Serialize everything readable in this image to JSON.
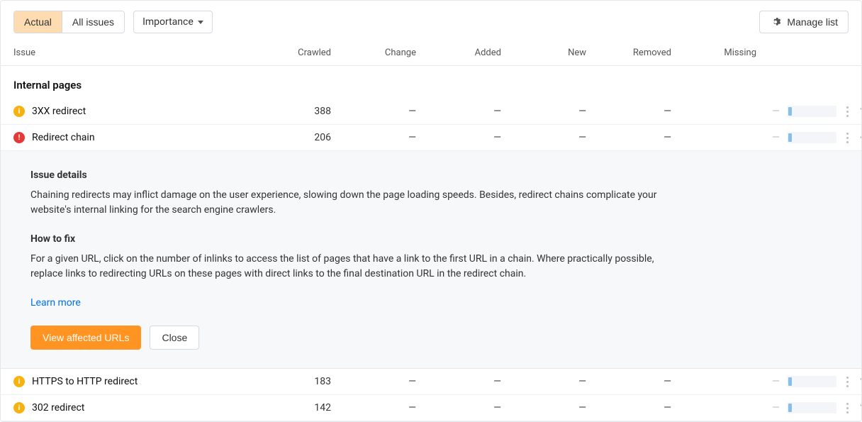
{
  "toolbar": {
    "tab_actual": "Actual",
    "tab_all": "All issues",
    "sort_label": "Importance",
    "manage_label": "Manage list"
  },
  "columns": {
    "issue": "Issue",
    "crawled": "Crawled",
    "change": "Change",
    "added": "Added",
    "new": "New",
    "removed": "Removed",
    "missing": "Missing"
  },
  "section_title": "Internal pages",
  "rows": [
    {
      "severity": "warning",
      "name": "3XX redirect",
      "crawled": "388",
      "expanded": false
    },
    {
      "severity": "error",
      "name": "Redirect chain",
      "crawled": "206",
      "expanded": true
    },
    {
      "severity": "warning",
      "name": "HTTPS to HTTP redirect",
      "crawled": "183",
      "expanded": false
    },
    {
      "severity": "warning",
      "name": "302 redirect",
      "crawled": "142",
      "expanded": false
    }
  ],
  "details": {
    "heading1": "Issue details",
    "body1": "Chaining redirects may inflict damage on the user experience, slowing down the page loading speeds. Besides, redirect chains complicate your website's internal linking for the search engine crawlers.",
    "heading2": "How to fix",
    "body2": "For a given URL, click on the number of inlinks to access the list of pages that have a link to the first URL in a chain. Where practically possible, replace links to redirecting URLs on these pages with direct links to the final destination URL in the redirect chain.",
    "learn_more": "Learn more",
    "view_btn": "View affected URLs",
    "close_btn": "Close"
  },
  "dash": "—"
}
